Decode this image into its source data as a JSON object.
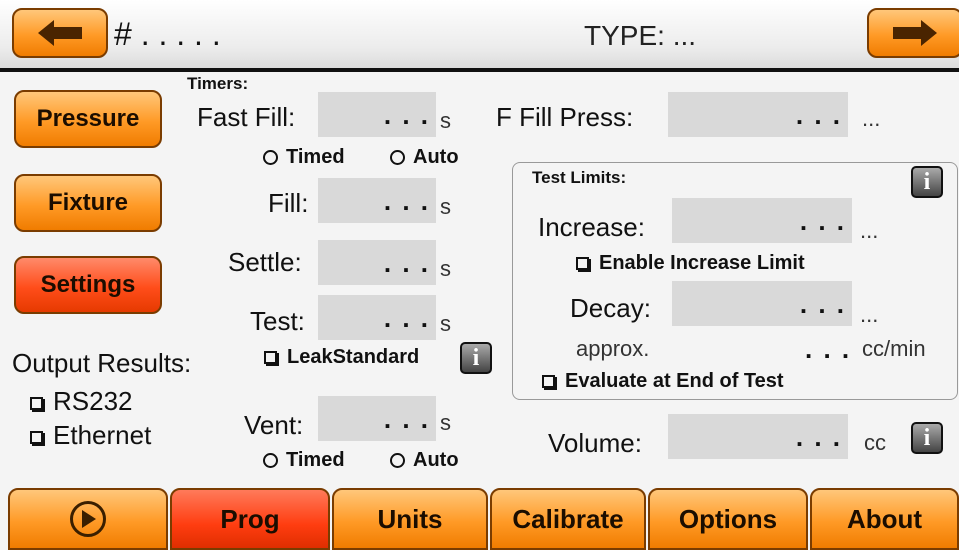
{
  "header": {
    "back_icon": "left-arrow-icon",
    "forward_icon": "right-arrow-icon",
    "program_number": "# . .  . . .",
    "type_label": "TYPE: ..."
  },
  "side_buttons": {
    "pressure": "Pressure",
    "fixture": "Fixture",
    "settings": "Settings"
  },
  "timers": {
    "section_label": "Timers:",
    "fast_fill": {
      "label": "Fast Fill:",
      "value": ". . .",
      "unit": "s"
    },
    "fast_fill_mode": {
      "timed": "Timed",
      "auto": "Auto"
    },
    "fill": {
      "label": "Fill:",
      "value": ". . .",
      "unit": "s"
    },
    "settle": {
      "label": "Settle:",
      "value": ". . .",
      "unit": "s"
    },
    "test": {
      "label": "Test:",
      "value": ". . .",
      "unit": "s"
    },
    "vent": {
      "label": "Vent:",
      "value": ". . .",
      "unit": "s"
    },
    "vent_mode": {
      "timed": "Timed",
      "auto": "Auto"
    }
  },
  "leak_standard": {
    "label": "LeakStandard"
  },
  "output_results": {
    "label": "Output Results:",
    "rs232": "RS232",
    "ethernet": "Ethernet"
  },
  "fast_fill_press": {
    "label": "F Fill Press:",
    "value": ". . .",
    "unit": "..."
  },
  "test_limits": {
    "title": "Test Limits:",
    "increase": {
      "label": "Increase:",
      "value": ". . .",
      "unit": "..."
    },
    "enable_increase": "Enable Increase Limit",
    "decay": {
      "label": "Decay:",
      "value": ". . .",
      "unit": "..."
    },
    "approx": {
      "label": "approx.",
      "value": ". . .",
      "unit": "cc/min"
    },
    "evaluate_end": "Evaluate at End of Test"
  },
  "volume": {
    "label": "Volume:",
    "value": ". . .",
    "unit": "cc"
  },
  "info_glyph": "i",
  "tabs": {
    "play_icon": "play-icon",
    "prog": "Prog",
    "units": "Units",
    "calibrate": "Calibrate",
    "options": "Options",
    "about": "About"
  },
  "colors": {
    "orange": "#ff9a26",
    "active_red": "#ff3d10",
    "field_gray": "#d9d9d9"
  }
}
